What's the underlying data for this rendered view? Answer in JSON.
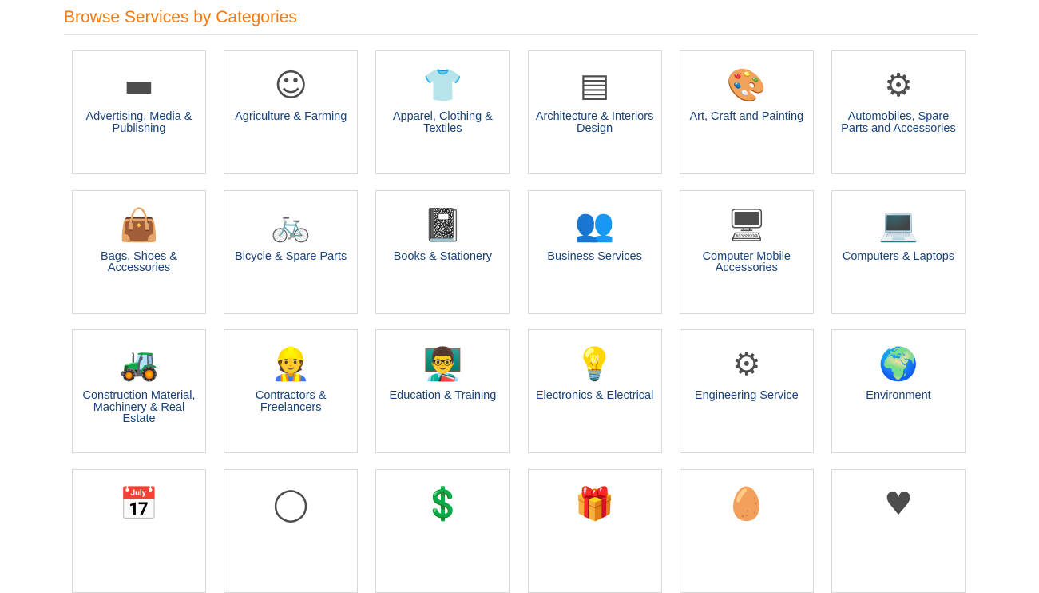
{
  "header": {
    "title": "Browse Services by Categories"
  },
  "colors": {
    "title": "#f7780f",
    "label": "#17427a",
    "icon": "#4d4d4d",
    "border": "#d9d9d9"
  },
  "categories": [
    {
      "label": "Advertising, Media & Publishing",
      "icon": "billboard-icon",
      "glyph": "▬"
    },
    {
      "label": "Agriculture & Farming",
      "icon": "chef-icon",
      "glyph": "☺"
    },
    {
      "label": "Apparel, Clothing & Textiles",
      "icon": "shirt-icon",
      "glyph": "👕"
    },
    {
      "label": "Architecture & Interiors Design",
      "icon": "blueprint-icon",
      "glyph": "▤"
    },
    {
      "label": "Art, Craft and Painting",
      "icon": "palette-icon",
      "glyph": "🎨"
    },
    {
      "label": "Automobiles, Spare Parts and Accessories",
      "icon": "engine-parts-icon",
      "glyph": "⚙"
    },
    {
      "label": "Bags, Shoes & Accessories",
      "icon": "bag-shoe-icon",
      "glyph": "👜"
    },
    {
      "label": "Bicycle & Spare Parts",
      "icon": "bicycle-icon",
      "glyph": "🚲"
    },
    {
      "label": "Books & Stationery",
      "icon": "book-icon",
      "glyph": "📓"
    },
    {
      "label": "Business Services",
      "icon": "business-people-icon",
      "glyph": "👥"
    },
    {
      "label": "Computer Mobile Accessories",
      "icon": "computer-mobile-icon",
      "glyph": "🖥"
    },
    {
      "label": "Computers & Laptops",
      "icon": "laptop-icon",
      "glyph": "💻"
    },
    {
      "label": "Construction Material, Machinery & Real Estate",
      "icon": "excavator-icon",
      "glyph": "🚜"
    },
    {
      "label": "Contractors & Freelancers",
      "icon": "worker-icon",
      "glyph": "👷"
    },
    {
      "label": "Education & Training",
      "icon": "teacher-icon",
      "glyph": "👨‍🏫"
    },
    {
      "label": "Electronics & Electrical",
      "icon": "bulb-icon",
      "glyph": "💡"
    },
    {
      "label": "Engineering Service",
      "icon": "engine-icon",
      "glyph": "⚙"
    },
    {
      "label": "Environment",
      "icon": "globe-plant-icon",
      "glyph": "🌍"
    },
    {
      "label": "",
      "icon": "calendar-clock-icon",
      "glyph": "📅"
    },
    {
      "label": "",
      "icon": "makeup-icon",
      "glyph": "◯"
    },
    {
      "label": "",
      "icon": "finance-person-icon",
      "glyph": "💲"
    },
    {
      "label": "",
      "icon": "gift-icon",
      "glyph": "🎁"
    },
    {
      "label": "",
      "icon": "easter-egg-icon",
      "glyph": "🥚"
    },
    {
      "label": "",
      "icon": "heart-hands-icon",
      "glyph": "♥"
    }
  ]
}
